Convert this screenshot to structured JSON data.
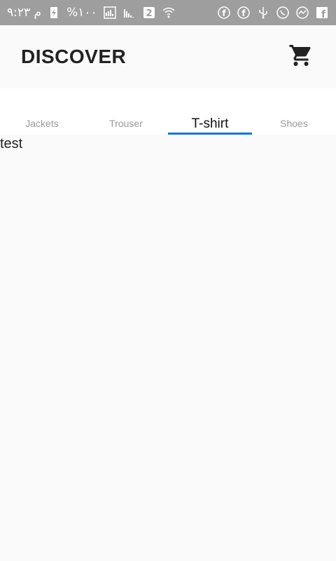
{
  "status_bar": {
    "time": "م ٩:٢٣",
    "battery_percent": "%١٠٠",
    "sim_label": "2",
    "left_icons": [
      "battery-charging-icon",
      "signal-icon",
      "signal-icon",
      "sim-2-icon",
      "wifi-icon"
    ],
    "right_icons": [
      "facebook-icon",
      "facebook-icon",
      "usb-icon",
      "whatsapp-icon",
      "messenger-icon",
      "facebook-square-icon"
    ]
  },
  "header": {
    "title": "DISCOVER",
    "cart_icon": "shopping-cart-icon"
  },
  "tabs": [
    {
      "label": "Jackets",
      "active": false
    },
    {
      "label": "Trouser",
      "active": false
    },
    {
      "label": "T-shirt",
      "active": true
    },
    {
      "label": "Shoes",
      "active": false
    }
  ],
  "content": {
    "text": "test"
  },
  "colors": {
    "status_bar_bg": "#9e9e9e",
    "tab_indicator": "#1976d2",
    "title_text": "#222222",
    "inactive_tab": "#9a9a9a"
  }
}
